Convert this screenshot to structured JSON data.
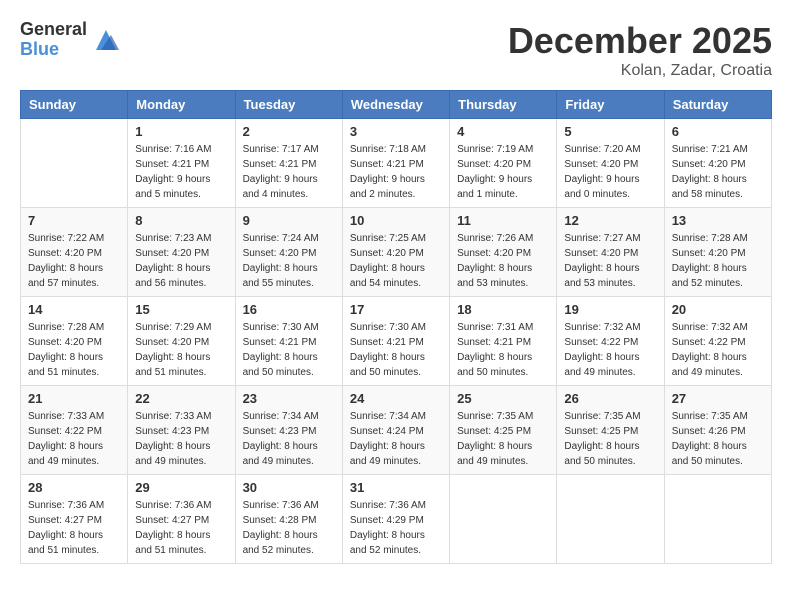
{
  "header": {
    "logo_general": "General",
    "logo_blue": "Blue",
    "month_title": "December 2025",
    "location": "Kolan, Zadar, Croatia"
  },
  "days_of_week": [
    "Sunday",
    "Monday",
    "Tuesday",
    "Wednesday",
    "Thursday",
    "Friday",
    "Saturday"
  ],
  "weeks": [
    [
      {
        "day": "",
        "sunrise": "",
        "sunset": "",
        "daylight": ""
      },
      {
        "day": "1",
        "sunrise": "7:16 AM",
        "sunset": "4:21 PM",
        "daylight": "9 hours and 5 minutes."
      },
      {
        "day": "2",
        "sunrise": "7:17 AM",
        "sunset": "4:21 PM",
        "daylight": "9 hours and 4 minutes."
      },
      {
        "day": "3",
        "sunrise": "7:18 AM",
        "sunset": "4:21 PM",
        "daylight": "9 hours and 2 minutes."
      },
      {
        "day": "4",
        "sunrise": "7:19 AM",
        "sunset": "4:20 PM",
        "daylight": "9 hours and 1 minute."
      },
      {
        "day": "5",
        "sunrise": "7:20 AM",
        "sunset": "4:20 PM",
        "daylight": "9 hours and 0 minutes."
      },
      {
        "day": "6",
        "sunrise": "7:21 AM",
        "sunset": "4:20 PM",
        "daylight": "8 hours and 58 minutes."
      }
    ],
    [
      {
        "day": "7",
        "sunrise": "7:22 AM",
        "sunset": "4:20 PM",
        "daylight": "8 hours and 57 minutes."
      },
      {
        "day": "8",
        "sunrise": "7:23 AM",
        "sunset": "4:20 PM",
        "daylight": "8 hours and 56 minutes."
      },
      {
        "day": "9",
        "sunrise": "7:24 AM",
        "sunset": "4:20 PM",
        "daylight": "8 hours and 55 minutes."
      },
      {
        "day": "10",
        "sunrise": "7:25 AM",
        "sunset": "4:20 PM",
        "daylight": "8 hours and 54 minutes."
      },
      {
        "day": "11",
        "sunrise": "7:26 AM",
        "sunset": "4:20 PM",
        "daylight": "8 hours and 53 minutes."
      },
      {
        "day": "12",
        "sunrise": "7:27 AM",
        "sunset": "4:20 PM",
        "daylight": "8 hours and 53 minutes."
      },
      {
        "day": "13",
        "sunrise": "7:28 AM",
        "sunset": "4:20 PM",
        "daylight": "8 hours and 52 minutes."
      }
    ],
    [
      {
        "day": "14",
        "sunrise": "7:28 AM",
        "sunset": "4:20 PM",
        "daylight": "8 hours and 51 minutes."
      },
      {
        "day": "15",
        "sunrise": "7:29 AM",
        "sunset": "4:20 PM",
        "daylight": "8 hours and 51 minutes."
      },
      {
        "day": "16",
        "sunrise": "7:30 AM",
        "sunset": "4:21 PM",
        "daylight": "8 hours and 50 minutes."
      },
      {
        "day": "17",
        "sunrise": "7:30 AM",
        "sunset": "4:21 PM",
        "daylight": "8 hours and 50 minutes."
      },
      {
        "day": "18",
        "sunrise": "7:31 AM",
        "sunset": "4:21 PM",
        "daylight": "8 hours and 50 minutes."
      },
      {
        "day": "19",
        "sunrise": "7:32 AM",
        "sunset": "4:22 PM",
        "daylight": "8 hours and 49 minutes."
      },
      {
        "day": "20",
        "sunrise": "7:32 AM",
        "sunset": "4:22 PM",
        "daylight": "8 hours and 49 minutes."
      }
    ],
    [
      {
        "day": "21",
        "sunrise": "7:33 AM",
        "sunset": "4:22 PM",
        "daylight": "8 hours and 49 minutes."
      },
      {
        "day": "22",
        "sunrise": "7:33 AM",
        "sunset": "4:23 PM",
        "daylight": "8 hours and 49 minutes."
      },
      {
        "day": "23",
        "sunrise": "7:34 AM",
        "sunset": "4:23 PM",
        "daylight": "8 hours and 49 minutes."
      },
      {
        "day": "24",
        "sunrise": "7:34 AM",
        "sunset": "4:24 PM",
        "daylight": "8 hours and 49 minutes."
      },
      {
        "day": "25",
        "sunrise": "7:35 AM",
        "sunset": "4:25 PM",
        "daylight": "8 hours and 49 minutes."
      },
      {
        "day": "26",
        "sunrise": "7:35 AM",
        "sunset": "4:25 PM",
        "daylight": "8 hours and 50 minutes."
      },
      {
        "day": "27",
        "sunrise": "7:35 AM",
        "sunset": "4:26 PM",
        "daylight": "8 hours and 50 minutes."
      }
    ],
    [
      {
        "day": "28",
        "sunrise": "7:36 AM",
        "sunset": "4:27 PM",
        "daylight": "8 hours and 51 minutes."
      },
      {
        "day": "29",
        "sunrise": "7:36 AM",
        "sunset": "4:27 PM",
        "daylight": "8 hours and 51 minutes."
      },
      {
        "day": "30",
        "sunrise": "7:36 AM",
        "sunset": "4:28 PM",
        "daylight": "8 hours and 52 minutes."
      },
      {
        "day": "31",
        "sunrise": "7:36 AM",
        "sunset": "4:29 PM",
        "daylight": "8 hours and 52 minutes."
      },
      {
        "day": "",
        "sunrise": "",
        "sunset": "",
        "daylight": ""
      },
      {
        "day": "",
        "sunrise": "",
        "sunset": "",
        "daylight": ""
      },
      {
        "day": "",
        "sunrise": "",
        "sunset": "",
        "daylight": ""
      }
    ]
  ]
}
